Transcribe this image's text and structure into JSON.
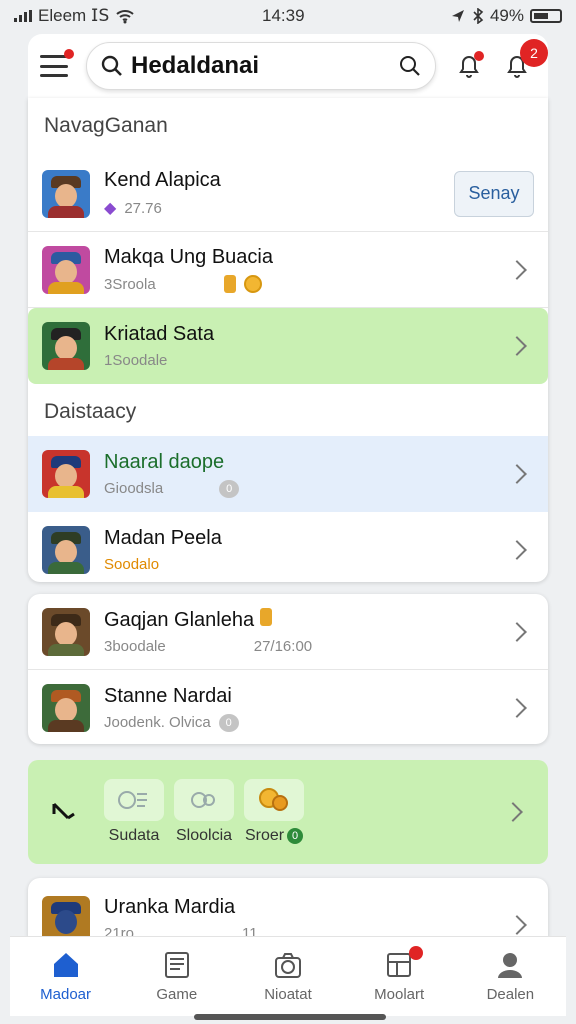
{
  "status_bar": {
    "carrier": "Eleem 𝖨𝖲",
    "time": "14:39",
    "battery": "49%"
  },
  "header": {
    "search_text": "Hedaldanai",
    "notif_count": "2"
  },
  "sections": [
    {
      "title": "NavagGanan",
      "rows": [
        {
          "title": "Kend Alapica",
          "sub": "27.76",
          "style": "normal",
          "action": "Senay",
          "avatar_color": "#3a7bc8"
        },
        {
          "title": "Makqa Ung Buacia",
          "sub": "3Sroola",
          "style": "normal",
          "avatar_color": "#c04aa0"
        },
        {
          "title": "Kriatad Sata",
          "sub": "1Soodale",
          "style": "green",
          "avatar_color": "#2f6e3a"
        }
      ]
    },
    {
      "title": "Daistaacy",
      "rows": [
        {
          "title": "Naaral daope",
          "sub": "Gioodsla",
          "style": "blue",
          "avatar_color": "#c8342c",
          "badge": "0"
        },
        {
          "title": "Madan Peela",
          "sub": "Soodalo",
          "style": "normal",
          "avatar_color": "#3a5d8a"
        }
      ]
    }
  ],
  "card2_rows": [
    {
      "title": "Gaqjan Glanleha",
      "sub": "3boodale",
      "meta": "27/16:00",
      "avatar_color": "#6b4a2a"
    },
    {
      "title": "Stanne Nardai",
      "sub": "Joodenk. Olvica",
      "badge": "0",
      "avatar_color": "#3d6b3a"
    }
  ],
  "feature": {
    "tiles": [
      {
        "label": "Sudata",
        "icon": "game-icon"
      },
      {
        "label": "Sloolcia",
        "icon": "controller-icon"
      },
      {
        "label": "Sroer",
        "icon": "trophy-icon",
        "badge": "0"
      }
    ]
  },
  "last_row": {
    "title": "Uranka Mardia",
    "sub": "21ro",
    "meta": "11."
  },
  "bottom_nav": [
    {
      "label": "Madoar",
      "icon": "home-icon",
      "active": true
    },
    {
      "label": "Game",
      "icon": "game-book-icon"
    },
    {
      "label": "Nioatat",
      "icon": "camera-icon"
    },
    {
      "label": "Moolart",
      "icon": "news-icon",
      "badge": true
    },
    {
      "label": "Dealen",
      "icon": "profile-icon"
    }
  ],
  "colors": {
    "green_bg": "#c9f0b3",
    "blue_bg": "#e4eefb",
    "accent": "#1e5fd0",
    "badge": "#e02424"
  }
}
